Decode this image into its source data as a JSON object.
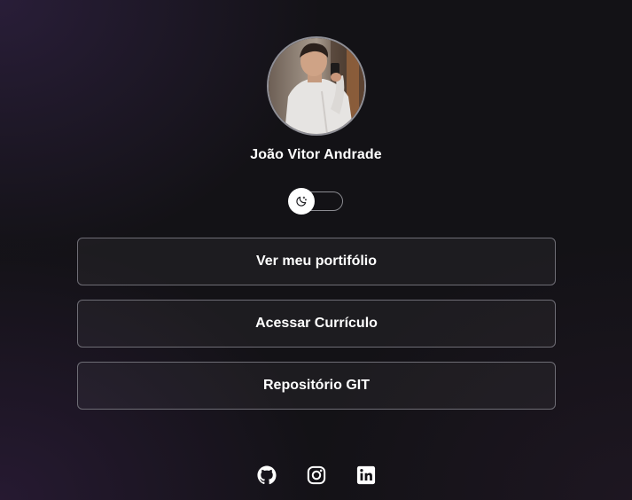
{
  "profile": {
    "name": "João Vitor Andrade"
  },
  "theme_toggle": {
    "state": "off",
    "icon": "moon-icon"
  },
  "links": [
    {
      "label": "Ver meu portifólio"
    },
    {
      "label": "Acessar Currículo"
    },
    {
      "label": "Repositório GIT"
    }
  ],
  "socials": [
    {
      "icon": "github-icon"
    },
    {
      "icon": "instagram-icon"
    },
    {
      "icon": "linkedin-icon"
    }
  ],
  "colors": {
    "background": "#131216",
    "button_border": "#6e6d75",
    "text": "#ffffff"
  }
}
